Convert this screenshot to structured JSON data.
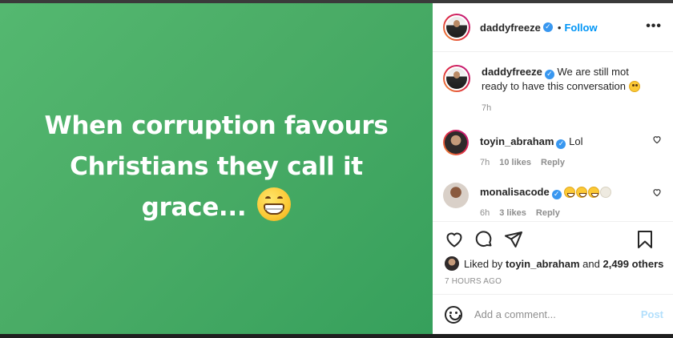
{
  "post": {
    "media_text": "When corruption favours Christians they call it grace...",
    "media_emoji": "grinning-face-with-smiling-eyes"
  },
  "header": {
    "username": "daddyfreeze",
    "follow_label": "Follow",
    "separator": "•"
  },
  "comments": [
    {
      "username": "daddyfreeze",
      "text": "We are still mot ready to have this conversation",
      "emoji": [
        "face-with-rolling-eyes"
      ],
      "time": "7h",
      "likes": "",
      "reply": ""
    },
    {
      "username": "toyin_abraham",
      "text": "Lol",
      "emoji": [],
      "time": "7h",
      "likes": "10 likes",
      "reply": "Reply"
    },
    {
      "username": "monalisacode",
      "text": "",
      "emoji": [
        "face-with-tears-of-joy",
        "face-with-tears-of-joy",
        "face-with-tears-of-joy",
        "face-with-tears-of-joy"
      ],
      "time": "6h",
      "likes": "3 likes",
      "reply": "Reply"
    }
  ],
  "likes_summary": {
    "prefix": "Liked by",
    "user": "toyin_abraham",
    "middle": "and",
    "others": "2,499 others"
  },
  "timestamp": "7 HOURS AGO",
  "composer": {
    "placeholder": "Add a comment...",
    "post_label": "Post"
  },
  "colors": {
    "media_green": "#4aac66",
    "follow_blue": "#0095f6",
    "verified_blue": "#3897f0",
    "post_disabled": "#b2dffc",
    "meta_gray": "#8e8e8e"
  },
  "icons": [
    "more-options-icon",
    "heart-icon",
    "comment-icon",
    "share-icon",
    "bookmark-icon",
    "emoji-icon",
    "verified-badge-icon"
  ]
}
